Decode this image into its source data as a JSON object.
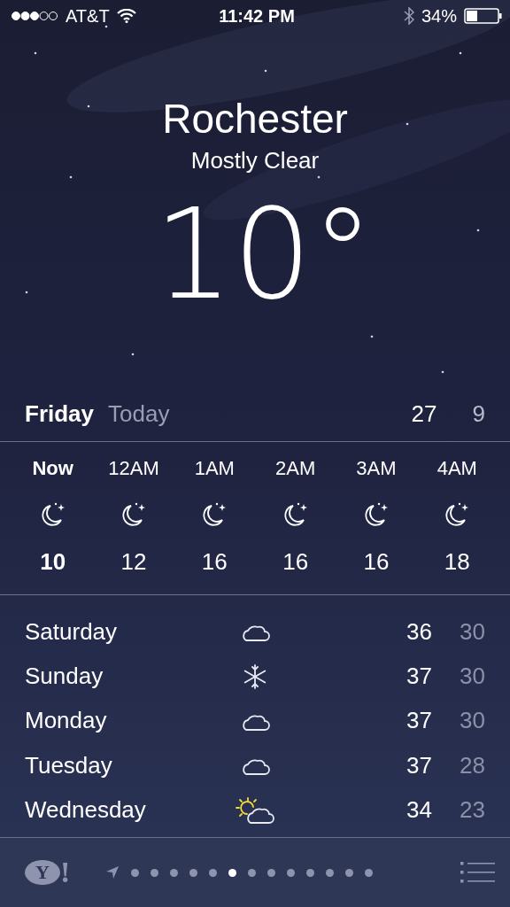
{
  "status_bar": {
    "carrier": "AT&T",
    "time": "11:42 PM",
    "battery_percent": "34%"
  },
  "location": {
    "city": "Rochester",
    "condition": "Mostly Clear",
    "temperature": "10°"
  },
  "today": {
    "day": "Friday",
    "label": "Today",
    "high": "27",
    "low": "9"
  },
  "hourly": [
    {
      "time": "Now",
      "kind": "clear-night",
      "temp": "10",
      "selected": true
    },
    {
      "time": "12AM",
      "kind": "clear-night",
      "temp": "12",
      "selected": false
    },
    {
      "time": "1AM",
      "kind": "clear-night",
      "temp": "16",
      "selected": false
    },
    {
      "time": "2AM",
      "kind": "clear-night",
      "temp": "16",
      "selected": false
    },
    {
      "time": "3AM",
      "kind": "clear-night",
      "temp": "16",
      "selected": false
    },
    {
      "time": "4AM",
      "kind": "clear-night",
      "temp": "18",
      "selected": false
    }
  ],
  "daily": [
    {
      "day": "Saturday",
      "kind": "cloudy",
      "high": "36",
      "low": "30"
    },
    {
      "day": "Sunday",
      "kind": "snow",
      "high": "37",
      "low": "30"
    },
    {
      "day": "Monday",
      "kind": "cloudy",
      "high": "37",
      "low": "30"
    },
    {
      "day": "Tuesday",
      "kind": "cloudy",
      "high": "37",
      "low": "28"
    },
    {
      "day": "Wednesday",
      "kind": "partly-sunny",
      "high": "34",
      "low": "23"
    }
  ],
  "bottom_bar": {
    "logo": {
      "letter": "Y",
      "mark": "!"
    },
    "pages": [
      {
        "selected": false
      },
      {
        "selected": false
      },
      {
        "selected": false
      },
      {
        "selected": false
      },
      {
        "selected": false
      },
      {
        "selected": true
      },
      {
        "selected": false
      },
      {
        "selected": false
      },
      {
        "selected": false
      },
      {
        "selected": false
      },
      {
        "selected": false
      },
      {
        "selected": false
      },
      {
        "selected": false
      }
    ]
  }
}
